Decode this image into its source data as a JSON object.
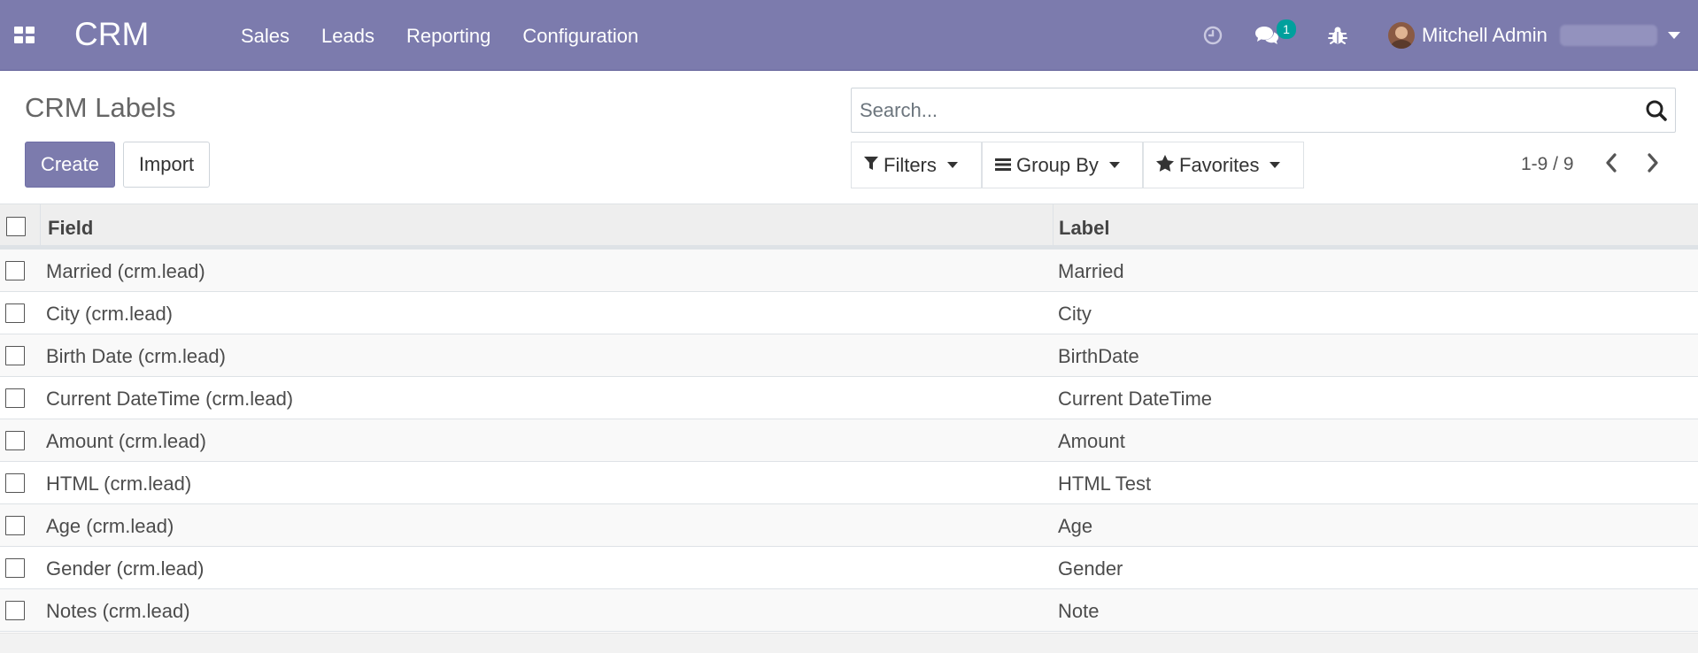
{
  "navbar": {
    "brand": "CRM",
    "menu": [
      "Sales",
      "Leads",
      "Reporting",
      "Configuration"
    ],
    "messages_count": "1",
    "user_name": "Mitchell Admin",
    "color": "#7c7bad"
  },
  "page": {
    "title": "CRM Labels",
    "create_label": "Create",
    "import_label": "Import"
  },
  "search": {
    "placeholder": "Search...",
    "filters_label": "Filters",
    "groupby_label": "Group By",
    "favorites_label": "Favorites"
  },
  "pager": {
    "value": "1-9 / 9"
  },
  "table": {
    "columns": [
      "Field",
      "Label"
    ],
    "rows": [
      {
        "field": "Married (crm.lead)",
        "label": "Married"
      },
      {
        "field": "City (crm.lead)",
        "label": "City"
      },
      {
        "field": "Birth Date (crm.lead)",
        "label": "BirthDate"
      },
      {
        "field": "Current DateTime (crm.lead)",
        "label": "Current DateTime"
      },
      {
        "field": "Amount (crm.lead)",
        "label": "Amount"
      },
      {
        "field": "HTML (crm.lead)",
        "label": "HTML Test"
      },
      {
        "field": "Age (crm.lead)",
        "label": "Age"
      },
      {
        "field": "Gender (crm.lead)",
        "label": "Gender"
      },
      {
        "field": "Notes (crm.lead)",
        "label": "Note"
      }
    ]
  }
}
